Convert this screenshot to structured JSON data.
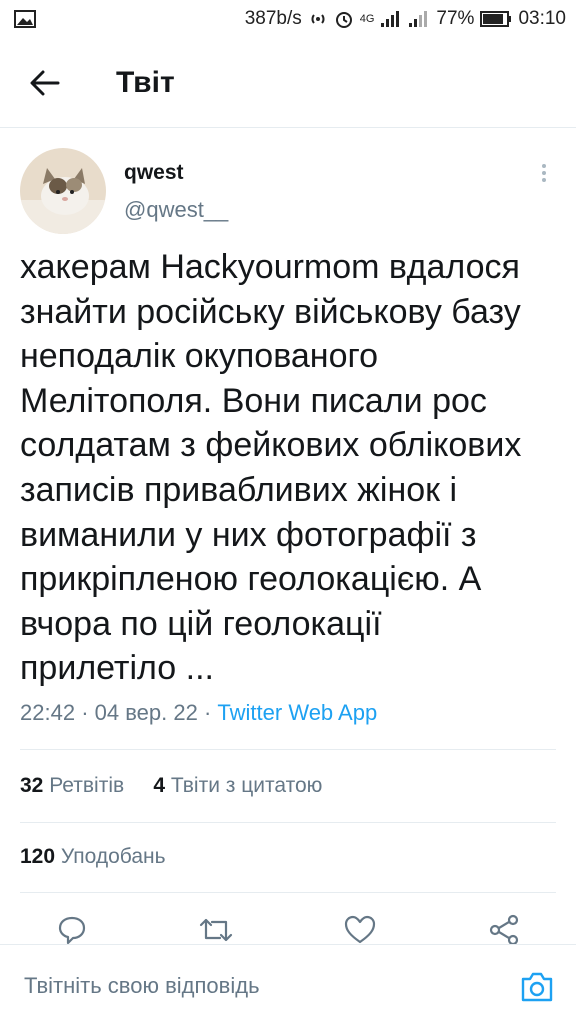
{
  "status_bar": {
    "speed": "387b/s",
    "network": "4G",
    "battery": "77%",
    "time": "03:10"
  },
  "header": {
    "back_icon": "arrow-left-icon",
    "title": "Твіт"
  },
  "tweet": {
    "author_name": "qwest",
    "author_handle": "@qwest__",
    "text": "хакерам Hackyourmom вдалося\nзнайти російську військову базу\nнеподалік окупованого\nМелітополя. Вони писали рос\nсолдатам з фейкових облікових\nзаписів привабливих жінок і\nвиманили у них фотографії з\nприкріпленою геолокацією. А\nвчора по цій геолокації\nприлетіло ...",
    "time": "22:42",
    "date": "04 вер. 22",
    "separator": "·",
    "source": "Twitter Web App"
  },
  "stats": {
    "retweets_count": "32",
    "retweets_label": "Ретвітів",
    "quotes_count": "4",
    "quotes_label": "Твіти з цитатою",
    "likes_count": "120",
    "likes_label": "Уподобань"
  },
  "actions": [
    "reply-icon",
    "retweet-icon",
    "like-icon",
    "share-icon"
  ],
  "reply": {
    "placeholder": "Твітніть свою відповідь"
  },
  "colors": {
    "accent": "#1da1f2",
    "text": "#14171a",
    "muted": "#657786",
    "divider": "#e6ecf0"
  }
}
